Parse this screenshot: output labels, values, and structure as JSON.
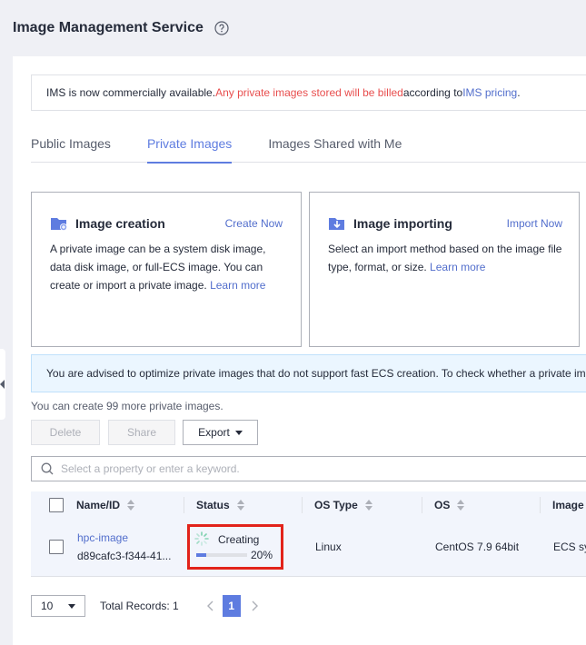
{
  "header": {
    "title": "Image Management Service"
  },
  "notice": {
    "part1": "IMS is now commercially available. ",
    "part2": "Any private images stored will be billed",
    "part3": " according to ",
    "link": "IMS pricing",
    "part4": "."
  },
  "tabs": [
    {
      "label": "Public Images"
    },
    {
      "label": "Private Images"
    },
    {
      "label": "Images Shared with Me"
    }
  ],
  "cards": {
    "creation": {
      "title": "Image creation",
      "link": "Create Now",
      "desc": "A private image can be a system disk image, data disk image, or full-ECS image. You can create or import a private image. ",
      "learn": "Learn more"
    },
    "importing": {
      "title": "Image importing",
      "link": "Import Now",
      "desc": "Select an import method based on the image file type, format, or size. ",
      "learn": "Learn more"
    }
  },
  "advice": "You are advised to optimize private images that do not support fast ECS creation. To check whether a private image supports fast ECS creation",
  "quota": "You can create 99 more private images.",
  "toolbar": {
    "delete": "Delete",
    "share": "Share",
    "export": "Export"
  },
  "search": {
    "placeholder": "Select a property or enter a keyword."
  },
  "table": {
    "columns": {
      "name": "Name/ID",
      "status": "Status",
      "os_type": "OS Type",
      "os": "OS",
      "image": "Image"
    },
    "rows": [
      {
        "name": "hpc-image",
        "id": "d89cafc3-f344-41...",
        "status": "Creating",
        "progress_text": "20%",
        "progress": 20,
        "os_type": "Linux",
        "os": "CentOS 7.9 64bit",
        "image": "ECS sy"
      }
    ]
  },
  "pager": {
    "page_size": "10",
    "total": "Total Records: 1",
    "current": "1"
  }
}
